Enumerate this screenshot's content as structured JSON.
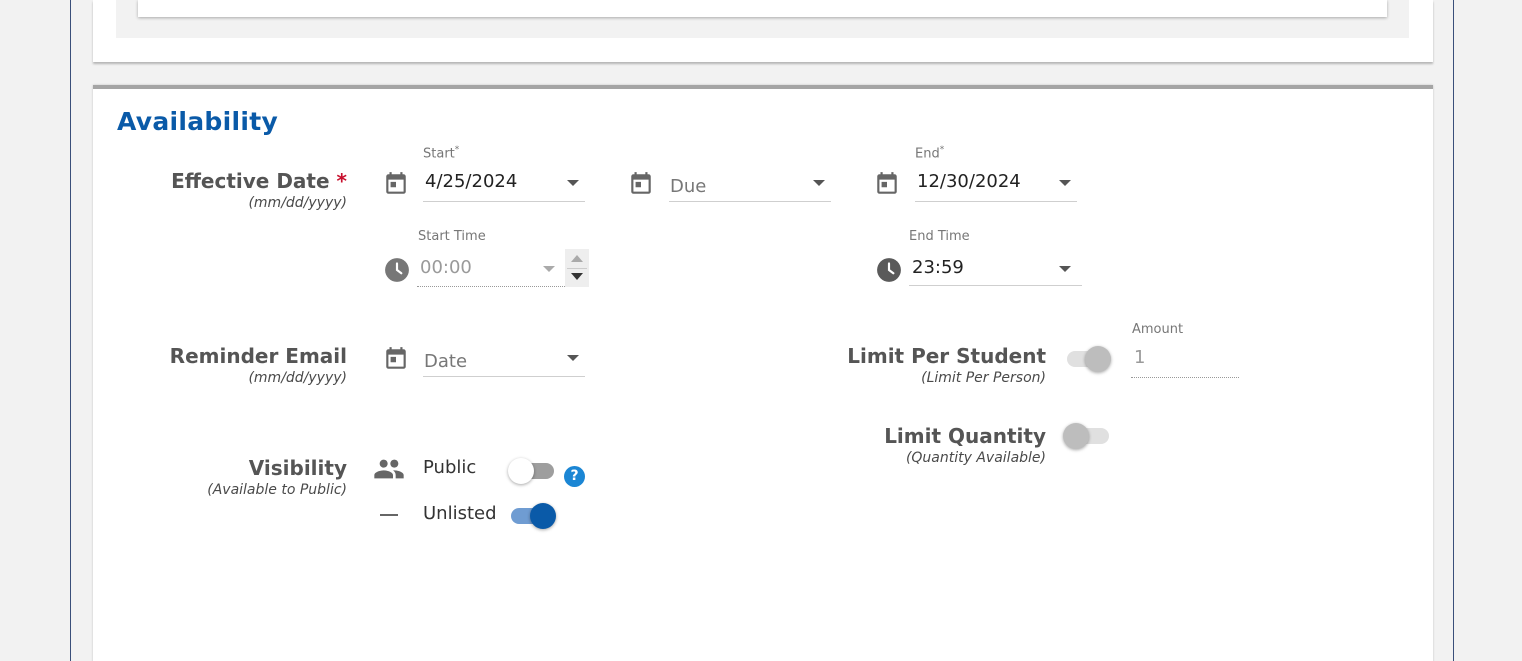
{
  "section": {
    "title": "Availability"
  },
  "effective_date": {
    "label": "Effective Date",
    "required_mark": "*",
    "sublabel": "(mm/dd/yyyy)",
    "start": {
      "label": "Start",
      "required_mark": "*",
      "value": "4/25/2024"
    },
    "due": {
      "placeholder": "Due",
      "value": ""
    },
    "end": {
      "label": "End",
      "required_mark": "*",
      "value": "12/30/2024"
    },
    "start_time": {
      "label": "Start Time",
      "value": "00:00",
      "disabled": true
    },
    "end_time": {
      "label": "End Time",
      "value": "23:59"
    }
  },
  "reminder_email": {
    "label": "Reminder Email",
    "sublabel": "(mm/dd/yyyy)",
    "date": {
      "placeholder": "Date",
      "value": ""
    }
  },
  "visibility": {
    "label": "Visibility",
    "sublabel": "(Available to Public)",
    "options": [
      {
        "label": "Public",
        "on": false,
        "icon": "people-icon"
      },
      {
        "label": "Unlisted",
        "on": true,
        "icon": "dash-icon"
      }
    ],
    "help": "?"
  },
  "limit_per_student": {
    "label": "Limit Per Student",
    "sublabel": "(Limit Per Person)",
    "on": false,
    "amount": {
      "label": "Amount",
      "value": "1",
      "disabled": true
    }
  },
  "limit_quantity": {
    "label": "Limit Quantity",
    "sublabel": "(Quantity Available)",
    "on": false
  },
  "colors": {
    "accent": "#0a5aa8",
    "toggle_on_knob": "#0a5aa8",
    "toggle_on_track": "#6f9cd2",
    "toggle_off_knob": "#ffffff",
    "toggle_off_track": "#9e9e9e",
    "toggle_disabled_knob": "#bdbdbd",
    "toggle_disabled_track": "#e0e0e0",
    "required": "#c8102e"
  }
}
